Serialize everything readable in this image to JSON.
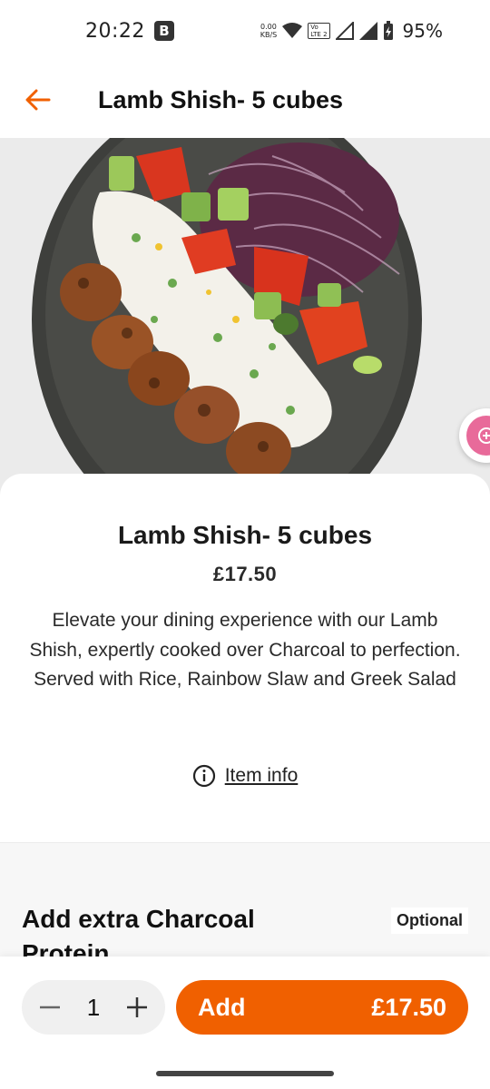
{
  "status_bar": {
    "time": "20:22",
    "b_badge": "B",
    "net_speed_value": "0.00",
    "net_speed_unit": "KB/S",
    "lte_top": "Vo",
    "lte_bottom": "LTE 2",
    "battery": "95%"
  },
  "header": {
    "title": "Lamb Shish- 5 cubes",
    "back_icon": "arrow-left-icon",
    "accent_color": "#f06000"
  },
  "item": {
    "title": "Lamb Shish- 5 cubes",
    "price": "£17.50",
    "description": "Elevate your dining experience with our Lamb Shish, expertly cooked over Charcoal to perfection. Served with Rice, Rainbow Slaw and Greek Salad",
    "info_label": "Item info"
  },
  "options": {
    "title": "Add extra Charcoal Protein",
    "badge": "Optional"
  },
  "footer": {
    "quantity": "1",
    "minus_icon": "minus-icon",
    "plus_icon": "plus-icon",
    "add_label": "Add",
    "add_price": "£17.50"
  }
}
